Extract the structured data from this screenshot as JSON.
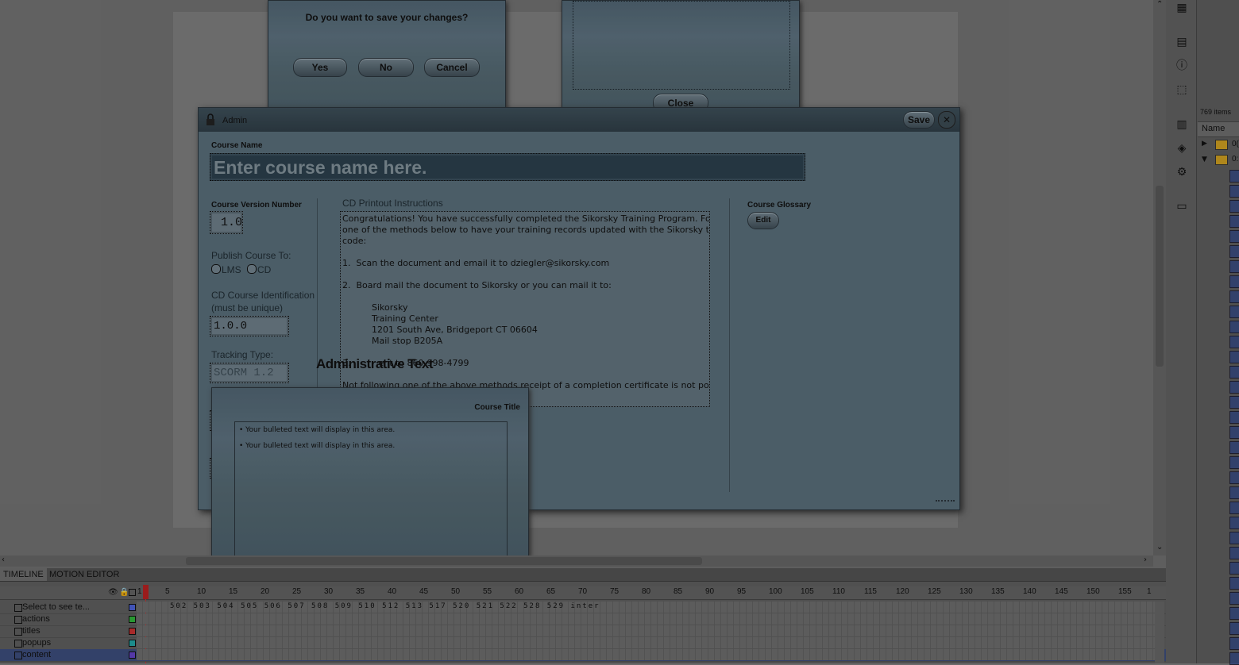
{
  "save_dialog": {
    "question": "Do you want to save your changes?",
    "yes": "Yes",
    "no": "No",
    "cancel": "Cancel"
  },
  "preview_dialog": {
    "close": "Close"
  },
  "admin": {
    "title": "Admin",
    "save": "Save",
    "close_glyph": "✕",
    "course_name_label": "Course Name",
    "course_name_placeholder": "Enter course name here.",
    "version_label": "Course Version Number",
    "version_value": "1.0",
    "publish_label": "Publish Course To:",
    "publish_opt_lms": "LMS",
    "publish_opt_cd": "CD",
    "cd_id_label_1": "CD Course Identification",
    "cd_id_label_2": "(must be unique)",
    "cd_id_value": "1.0.0",
    "tracking_label": "Tracking Type:",
    "tracking_value": "SCORM 1.2",
    "instructions_label": "CD Printout Instructions",
    "instructions_lines": [
      "Congratulations! You have successfully completed the Sikorsky Training Program. Follow",
      "one of the methods below to have your training records updated with the Sikorsky training",
      "code:",
      "",
      "1.  Scan the document and email it to dziegler@sikorsky.com",
      "",
      "2.  Board mail the document to Sikorsky or you can mail it to:",
      "",
      "Sikorsky",
      "Training Center",
      "1201 South Ave, Bridgeport CT 06604",
      "Mail stop B205A",
      "",
      "3.          ent to 860-998-4799",
      "",
      "Not following one of the above methods receipt of a completion certificate is not possible."
    ],
    "glossary_label": "Course Glossary",
    "glossary_edit": "Edit"
  },
  "overlay_heading": "Administrative Text",
  "course_popup": {
    "title": "Course Title",
    "bullets": [
      "Your bulleted text will display in this area.",
      "Your bulleted text will display in this area."
    ]
  },
  "timeline": {
    "tabs": [
      "TIMELINE",
      "MOTION EDITOR"
    ],
    "ruler": [
      "1",
      "5",
      "10",
      "15",
      "20",
      "25",
      "30",
      "35",
      "40",
      "45",
      "50",
      "55",
      "60",
      "65",
      "70",
      "75",
      "80",
      "85",
      "90",
      "95",
      "100",
      "105",
      "110",
      "115",
      "120",
      "125",
      "130",
      "135",
      "140",
      "145",
      "150",
      "155",
      "1"
    ],
    "layers": [
      {
        "name": "Select to see te...",
        "color": "#4a5fd0"
      },
      {
        "name": "actions",
        "color": "#2fae3a"
      },
      {
        "name": "titles",
        "color": "#c03030"
      },
      {
        "name": "popups",
        "color": "#20a0a0"
      },
      {
        "name": "content",
        "color": "#6040c0"
      }
    ],
    "frame_labels": "502 503 504 505 506 507 508 509 510 512 513 517 520 521 522 528 529 inter"
  },
  "library": {
    "count": "769 items",
    "name_header": "Name",
    "folder_labels": [
      "0(",
      "0:"
    ]
  }
}
